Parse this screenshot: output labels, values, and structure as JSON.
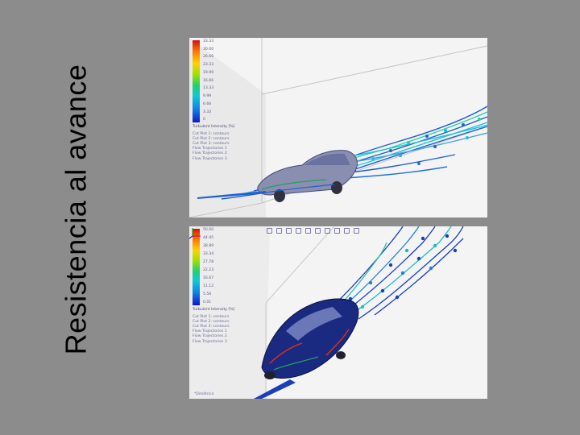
{
  "slide": {
    "title": "Resistencia al avance"
  },
  "top_view": {
    "legend_values": [
      "33.33",
      "30.00",
      "26.66",
      "23.33",
      "19.99",
      "16.66",
      "13.33",
      "9.99",
      "6.66",
      "3.33",
      "0"
    ],
    "legend_caption": "Turbulent Intensity [%]",
    "overlay_items": [
      "Cut Plot 1: contours",
      "Cut Plot 2: contours",
      "Cut Plot 3: contours",
      "Flow Trajectories 1",
      "Flow Trajectories 2",
      "Flow Trajectories 3"
    ],
    "colors": {
      "flow": "#1f5fd0",
      "body": "#8a8fb0",
      "stream_fast": "#30d0c0"
    }
  },
  "bottom_view": {
    "legend_values": [
      "50.00",
      "44.45",
      "38.89",
      "33.34",
      "27.78",
      "22.23",
      "16.67",
      "11.12",
      "5.56",
      "0.01"
    ],
    "legend_caption": "Turbulent Intensity [%]",
    "overlay_items": [
      "Cut Plot 1: contours",
      "Cut Plot 2: contours",
      "Cut Plot 3: contours",
      "Flow Trajectories 1",
      "Flow Trajectories 2",
      "Flow Trajectories 3"
    ],
    "status": "*Dimétrica",
    "colors": {
      "flow": "#1a3fb8",
      "body": "#1a2a80"
    }
  }
}
